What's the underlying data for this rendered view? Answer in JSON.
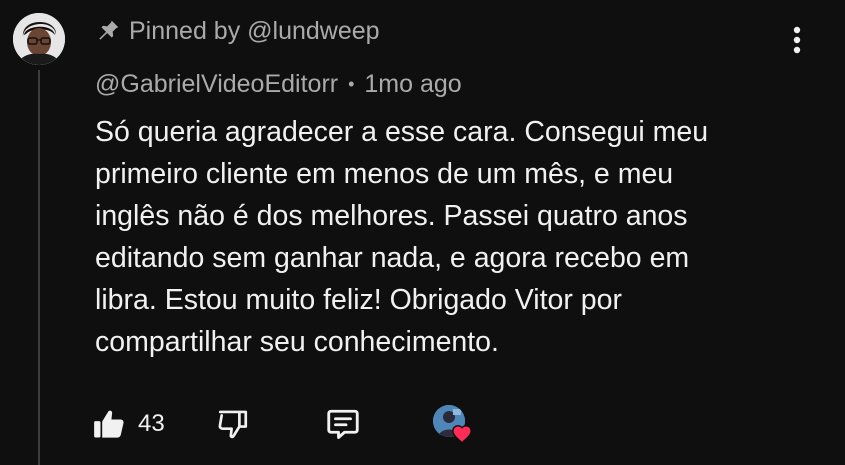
{
  "pinned": {
    "label": "Pinned by @lundweep",
    "icon": "pin-icon"
  },
  "author": {
    "handle": "@GabrielVideoEditorr",
    "separator": "•",
    "time": "1mo ago"
  },
  "comment": {
    "text": "Só queria agradecer a esse cara. Consegui meu\nprimeiro cliente em menos de um mês, e meu\ninglês não é dos melhores. Passei quatro anos\neditando sem ganhar nada, e agora recebo em\nlibra. Estou muito feliz! Obrigado Vitor por\ncompartilhar seu conhecimento."
  },
  "actions": {
    "like_count": "43",
    "like_icon": "thumbs-up-icon",
    "dislike_icon": "thumbs-down-icon",
    "reply_icon": "reply-icon",
    "heart_icon": "heart-icon"
  },
  "colors": {
    "background": "#0f0f0f",
    "text_primary": "#f1f1f1",
    "text_secondary": "#aaaaaa",
    "heart": "#ff2d55"
  }
}
